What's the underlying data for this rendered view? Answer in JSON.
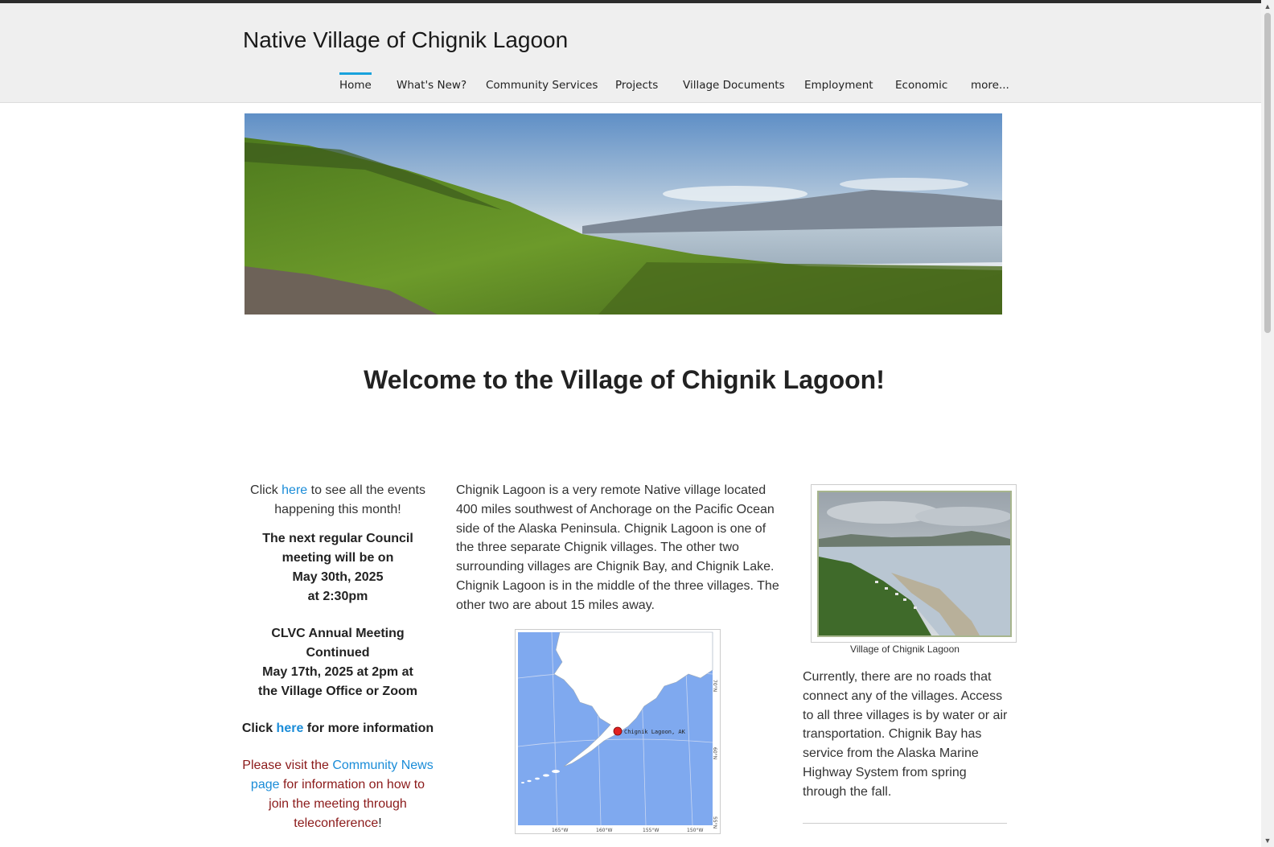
{
  "site": {
    "title": "Native Village of Chignik Lagoon"
  },
  "nav": {
    "items": [
      {
        "label": "Home",
        "active": true
      },
      {
        "label": "What's New?"
      },
      {
        "label": "Community Services"
      },
      {
        "label": "Projects"
      },
      {
        "label": "Village Documents"
      },
      {
        "label": "Employment"
      },
      {
        "label": "Economic"
      },
      {
        "label": "more..."
      }
    ],
    "accent_color": "#19a2dc"
  },
  "main": {
    "welcome": "Welcome to the Village of Chignik Lagoon!"
  },
  "left_col": {
    "events_click": "Click",
    "events_link": "here",
    "events_rest": "to see all the events happening this month!",
    "council_line1": "The next regular Council meeting will be on",
    "council_date": "May 30th, 2025",
    "council_time": "at 2:30pm",
    "annual_title": "CLVC Annual Meeting Continued",
    "annual_date": "May 17th, 2025 at 2pm at",
    "annual_place": "the Village Office or Zoom",
    "info_click": "Click",
    "info_link": "here",
    "info_rest": "for more information",
    "visit_text": "Please visit the",
    "visit_link": "Community News page",
    "visit_rest": "for information on how to join the meeting through teleconference",
    "visit_end": "!"
  },
  "mid_col": {
    "paragraph": "Chignik Lagoon is a very remote Native village located 400 miles southwest of Anchorage on the Pacific Ocean side of the Alaska Peninsula. Chignik Lagoon is one of the three separate Chignik villages. The other two surrounding villages are Chignik Bay, and Chignik Lake. Chignik Lagoon is in the middle of the three villages. The other two are about 15 miles away.",
    "map_label": "Chignik Lagoon, AK",
    "map_ticks_bottom": [
      "165°W",
      "160°W",
      "155°W",
      "150°W"
    ],
    "map_ticks_right": [
      "70°N",
      "60°N",
      "55°N"
    ]
  },
  "right_col": {
    "caption": "Village of Chignik Lagoon",
    "paragraph": "Currently, there are no roads that connect any of the villages.  Access to all three villages is by water or air transportation. Chignik Bay has service from the Alaska Marine Highway System from spring through the fall."
  }
}
